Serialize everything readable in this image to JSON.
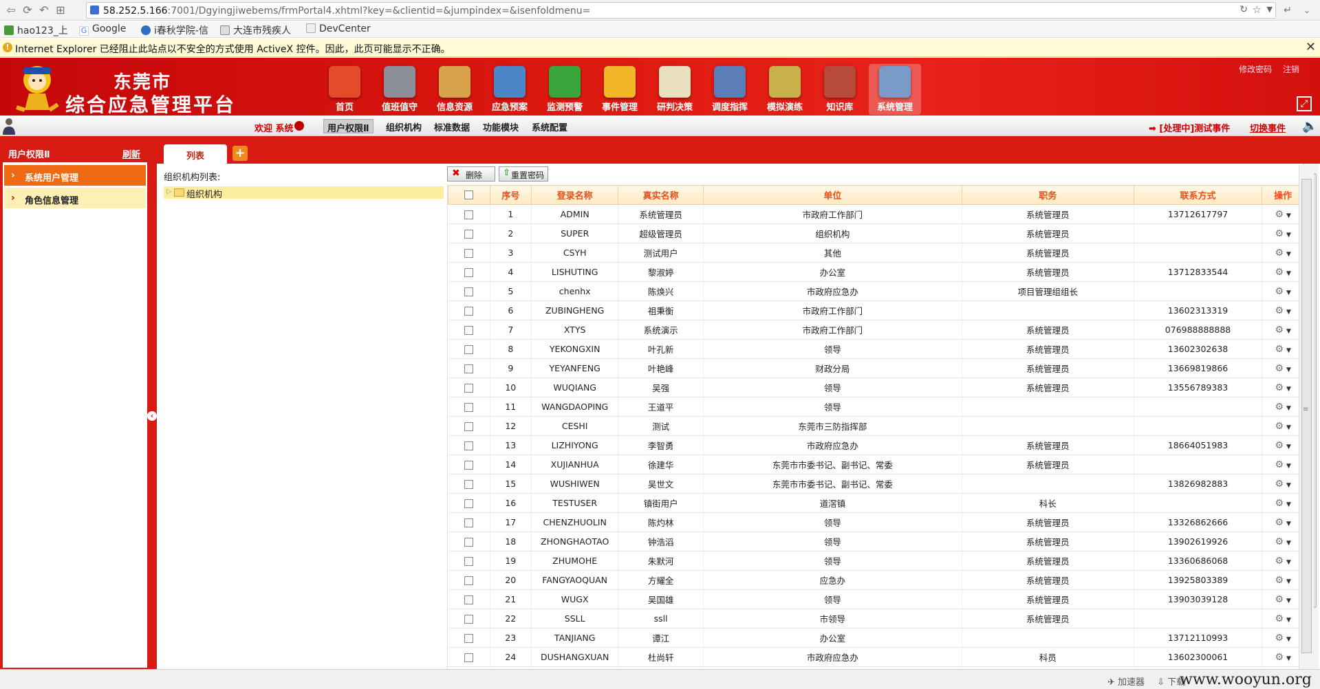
{
  "browser": {
    "url_host": "58.252.5.166",
    "url_path": ":7001/Dgyingjiwebems/frmPortal4.xhtml?key=&clientid=&jumpindex=&isenfoldmenu=",
    "bookmarks": [
      "hao123_上",
      "Google",
      "i春秋学院-信",
      "大连市残疾人",
      "DevCenter"
    ],
    "infobar": "Internet Explorer 已经阻止此站点以不安全的方式使用 ActiveX 控件。因此，此页可能显示不正确。",
    "infobar_close": "✕"
  },
  "header": {
    "city": "东莞市",
    "title": "综合应急管理平台",
    "links": [
      "修改密码",
      "注销"
    ],
    "modules": [
      {
        "label": "首页",
        "icon": "home-icon",
        "color": "#e44b2a"
      },
      {
        "label": "值班值守",
        "icon": "duty-icon",
        "color": "#8a8f9a"
      },
      {
        "label": "信息资源",
        "icon": "info-resource-icon",
        "color": "#d8a24a"
      },
      {
        "label": "应急预案",
        "icon": "emergency-plan-icon",
        "color": "#4a86c8"
      },
      {
        "label": "监测预警",
        "icon": "monitor-warning-icon",
        "color": "#3aa53a"
      },
      {
        "label": "事件管理",
        "icon": "event-folder-icon",
        "color": "#f0b828"
      },
      {
        "label": "研判决策",
        "icon": "decision-icon",
        "color": "#e9e0c0"
      },
      {
        "label": "调度指挥",
        "icon": "dispatch-icon",
        "color": "#5a7fb8"
      },
      {
        "label": "模拟演练",
        "icon": "drill-icon",
        "color": "#c9b14a"
      },
      {
        "label": "知识库",
        "icon": "knowledge-books-icon",
        "color": "#b84a3a"
      },
      {
        "label": "系统管理",
        "icon": "system-settings-icon",
        "color": "#7a9ac8"
      }
    ],
    "active_module": "系统管理"
  },
  "subnav": {
    "welcome": "欢迎 系统",
    "items": [
      "用户权限Ⅱ",
      "组织机构",
      "标准数据",
      "功能模块",
      "系统配置"
    ],
    "active": "用户权限Ⅱ",
    "event_status": "[处理中]测试事件",
    "switch_event": "切换事件"
  },
  "left": {
    "title": "用户权限Ⅱ",
    "refresh": "刷新",
    "menu": [
      "系统用户管理",
      "角色信息管理"
    ],
    "active": "系统用户管理"
  },
  "main": {
    "tab": "列表",
    "org_list_label": "组织机构列表:",
    "tree_root": "组织机构",
    "buttons": {
      "delete": "删除",
      "reset_password": "重置密码"
    },
    "columns": [
      "",
      "序号",
      "登录名称",
      "真实名称",
      "单位",
      "职务",
      "联系方式",
      "操作"
    ],
    "rows": [
      [
        "1",
        "ADMIN",
        "系统管理员",
        "市政府工作部门",
        "系统管理员",
        "13712617797"
      ],
      [
        "2",
        "SUPER",
        "超级管理员",
        "组织机构",
        "系统管理员",
        ""
      ],
      [
        "3",
        "CSYH",
        "测试用户",
        "其他",
        "系统管理员",
        ""
      ],
      [
        "4",
        "LISHUTING",
        "黎淑婷",
        "办公室",
        "系统管理员",
        "13712833544"
      ],
      [
        "5",
        "chenhx",
        "陈焕兴",
        "市政府应急办",
        "项目管理组组长",
        ""
      ],
      [
        "6",
        "ZUBINGHENG",
        "祖秉衡",
        "市政府工作部门",
        "",
        "13602313319"
      ],
      [
        "7",
        "XTYS",
        "系统演示",
        "市政府工作部门",
        "系统管理员",
        "076988888888"
      ],
      [
        "8",
        "YEKONGXIN",
        "叶孔新",
        "领导",
        "系统管理员",
        "13602302638"
      ],
      [
        "9",
        "YEYANFENG",
        "叶艳峰",
        "财政分局",
        "系统管理员",
        "13669819866"
      ],
      [
        "10",
        "WUQIANG",
        "吴强",
        "领导",
        "系统管理员",
        "13556789383"
      ],
      [
        "11",
        "WANGDAOPING",
        "王道平",
        "领导",
        "",
        ""
      ],
      [
        "12",
        "CESHI",
        "测试",
        "东莞市三防指挥部",
        "",
        ""
      ],
      [
        "13",
        "LIZHIYONG",
        "李智勇",
        "市政府应急办",
        "系统管理员",
        "18664051983"
      ],
      [
        "14",
        "XUJIANHUA",
        "徐建华",
        "东莞市市委书记、副书记、常委",
        "系统管理员",
        ""
      ],
      [
        "15",
        "WUSHIWEN",
        "吴世文",
        "东莞市市委书记、副书记、常委",
        "",
        "13826982883"
      ],
      [
        "16",
        "TESTUSER",
        "镇街用户",
        "道滘镇",
        "科长",
        ""
      ],
      [
        "17",
        "CHENZHUOLIN",
        "陈灼林",
        "领导",
        "系统管理员",
        "13326862666"
      ],
      [
        "18",
        "ZHONGHAOTAO",
        "钟浩滔",
        "领导",
        "系统管理员",
        "13902619926"
      ],
      [
        "19",
        "ZHUMOHE",
        "朱默河",
        "领导",
        "系统管理员",
        "13360686068"
      ],
      [
        "20",
        "FANGYAOQUAN",
        "方耀全",
        "应急办",
        "系统管理员",
        "13925803389"
      ],
      [
        "21",
        "WUGX",
        "吴国雄",
        "领导",
        "系统管理员",
        "13903039128"
      ],
      [
        "22",
        "SSLL",
        "ssll",
        "市领导",
        "系统管理员",
        ""
      ],
      [
        "23",
        "TANJIANG",
        "谭江",
        "办公室",
        "",
        "13712110993"
      ],
      [
        "24",
        "DUSHANGXUAN",
        "杜尚轩",
        "市政府应急办",
        "科员",
        "13602300061"
      ]
    ]
  },
  "statusbar": {
    "accelerator": "加速器",
    "download": "下载",
    "watermark": "www.wooyun.org"
  }
}
